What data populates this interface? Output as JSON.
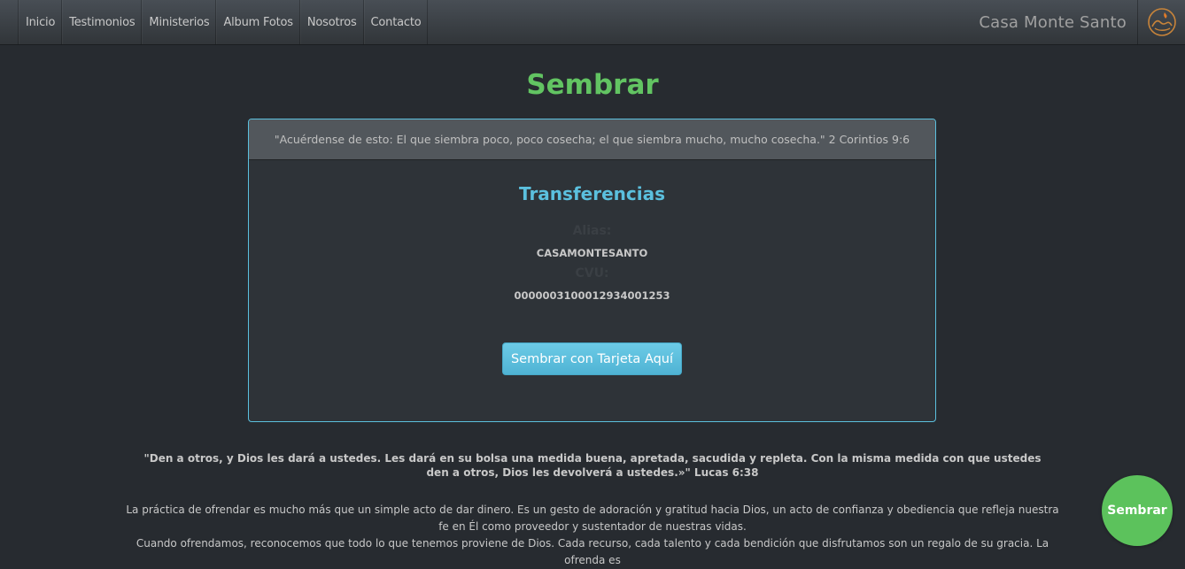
{
  "nav": {
    "items": [
      {
        "label": "Inicio"
      },
      {
        "label": "Testimonios"
      },
      {
        "label": "Ministerios"
      },
      {
        "label": "Album Fotos"
      },
      {
        "label": "Nosotros"
      },
      {
        "label": "Contacto"
      }
    ],
    "brand": "Casa Monte Santo",
    "logo_icon": "hand-flame-logo-icon"
  },
  "page": {
    "title": "Sembrar"
  },
  "card": {
    "header_quote": "\"Acuérdense de esto: El que siembra poco, poco cosecha; el que siembra mucho, mucho cosecha.\" 2 Corintios 9:6",
    "title": "Transferencias",
    "alias_label": "Alias:",
    "alias_value": "CASAMONTESANTO",
    "cvu_label": "CVU:",
    "cvu_value": "0000003100012934001253",
    "button_label": "Sembrar con Tarjeta Aquí"
  },
  "quote": "\"Den a otros, y Dios les dará a ustedes. Les dará en su bolsa una medida buena, apretada, sacudida y repleta. Con la misma medida con que ustedes den a otros, Dios les devolverá a ustedes.»\" Lucas 6:38",
  "paragraph": {
    "line1": "La práctica de ofrendar es mucho más que un simple acto de dar dinero. Es un gesto de adoración y gratitud hacia Dios, un acto de confianza y obediencia que refleja nuestra fe en Él como proveedor y sustentador de nuestras vidas.",
    "line2": "Cuando ofrendamos, reconocemos que todo lo que tenemos proviene de Dios. Cada recurso, cada talento y cada bendición que disfrutamos son un regalo de su gracia. La ofrenda es"
  },
  "fab": {
    "label": "Sembrar"
  },
  "colors": {
    "background": "#272b30",
    "accent_green": "#62c462",
    "accent_info": "#5bc0de"
  }
}
